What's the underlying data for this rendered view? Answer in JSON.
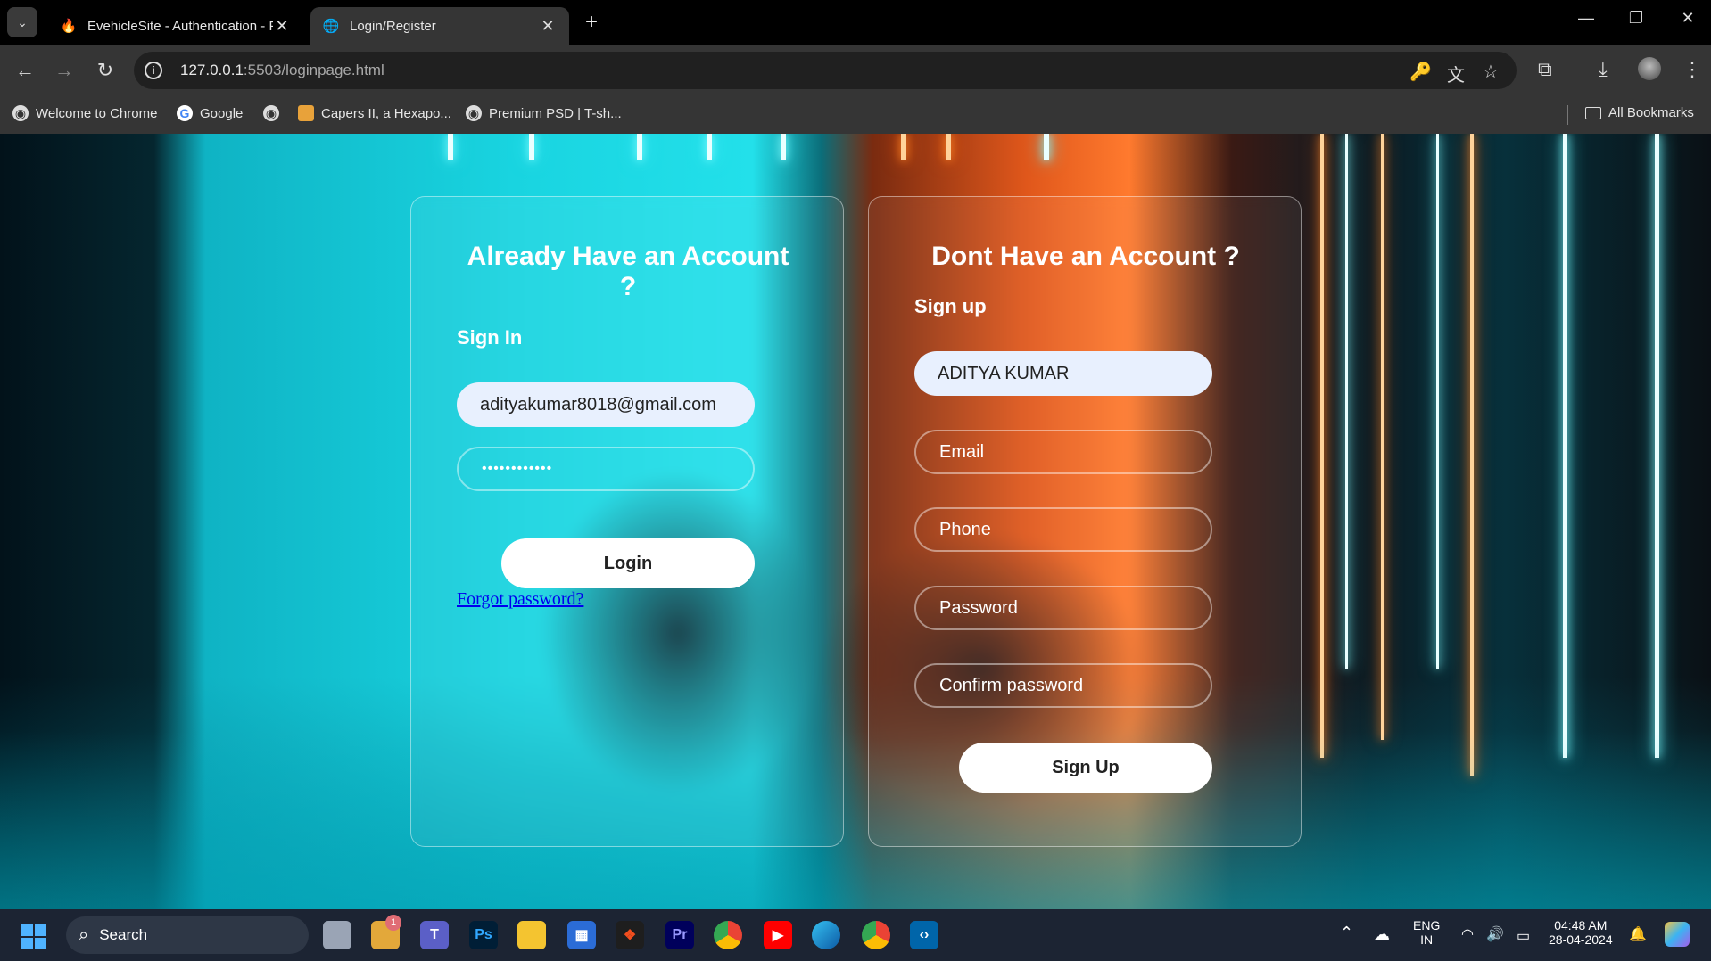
{
  "browser": {
    "tabs": [
      {
        "title": "EvehicleSite - Authentication - F",
        "favicon": "firebase-icon",
        "active": false
      },
      {
        "title": "Login/Register",
        "favicon": "globe-icon",
        "active": true
      }
    ],
    "url_host": "127.0.0.1",
    "url_rest": ":5503/loginpage.html",
    "bookmarks": [
      {
        "label": "Welcome to Chrome",
        "icon": "globe-icon"
      },
      {
        "label": "Google",
        "icon": "google-icon"
      },
      {
        "label": "",
        "icon": "globe-icon"
      },
      {
        "label": "Capers II, a Hexapo...",
        "icon": "bookmark-site-icon"
      },
      {
        "label": "Premium PSD | T-sh...",
        "icon": "globe-icon"
      }
    ],
    "all_bookmarks": "All Bookmarks"
  },
  "signin": {
    "heading": "Already Have an Account ?",
    "subtitle": "Sign In",
    "email_value": "adityakumar8018@gmail.com",
    "password_value": "••••••••••••",
    "login_label": "Login",
    "forgot_label": "Forgot password?"
  },
  "signup": {
    "heading": "Dont Have an Account ?",
    "subtitle": "Sign up",
    "name_value": "ADITYA KUMAR",
    "email_placeholder": "Email",
    "phone_placeholder": "Phone",
    "password_placeholder": "Password",
    "confirm_placeholder": "Confirm password",
    "signup_label": "Sign Up"
  },
  "taskbar": {
    "search_label": "Search",
    "badge_count": "1",
    "lang_top": "ENG",
    "lang_bottom": "IN",
    "time": "04:48 AM",
    "date": "28-04-2024"
  },
  "colors": {
    "tab_active": "#353535",
    "input_filled": "#e8f0fe",
    "link": "#0000ee"
  }
}
